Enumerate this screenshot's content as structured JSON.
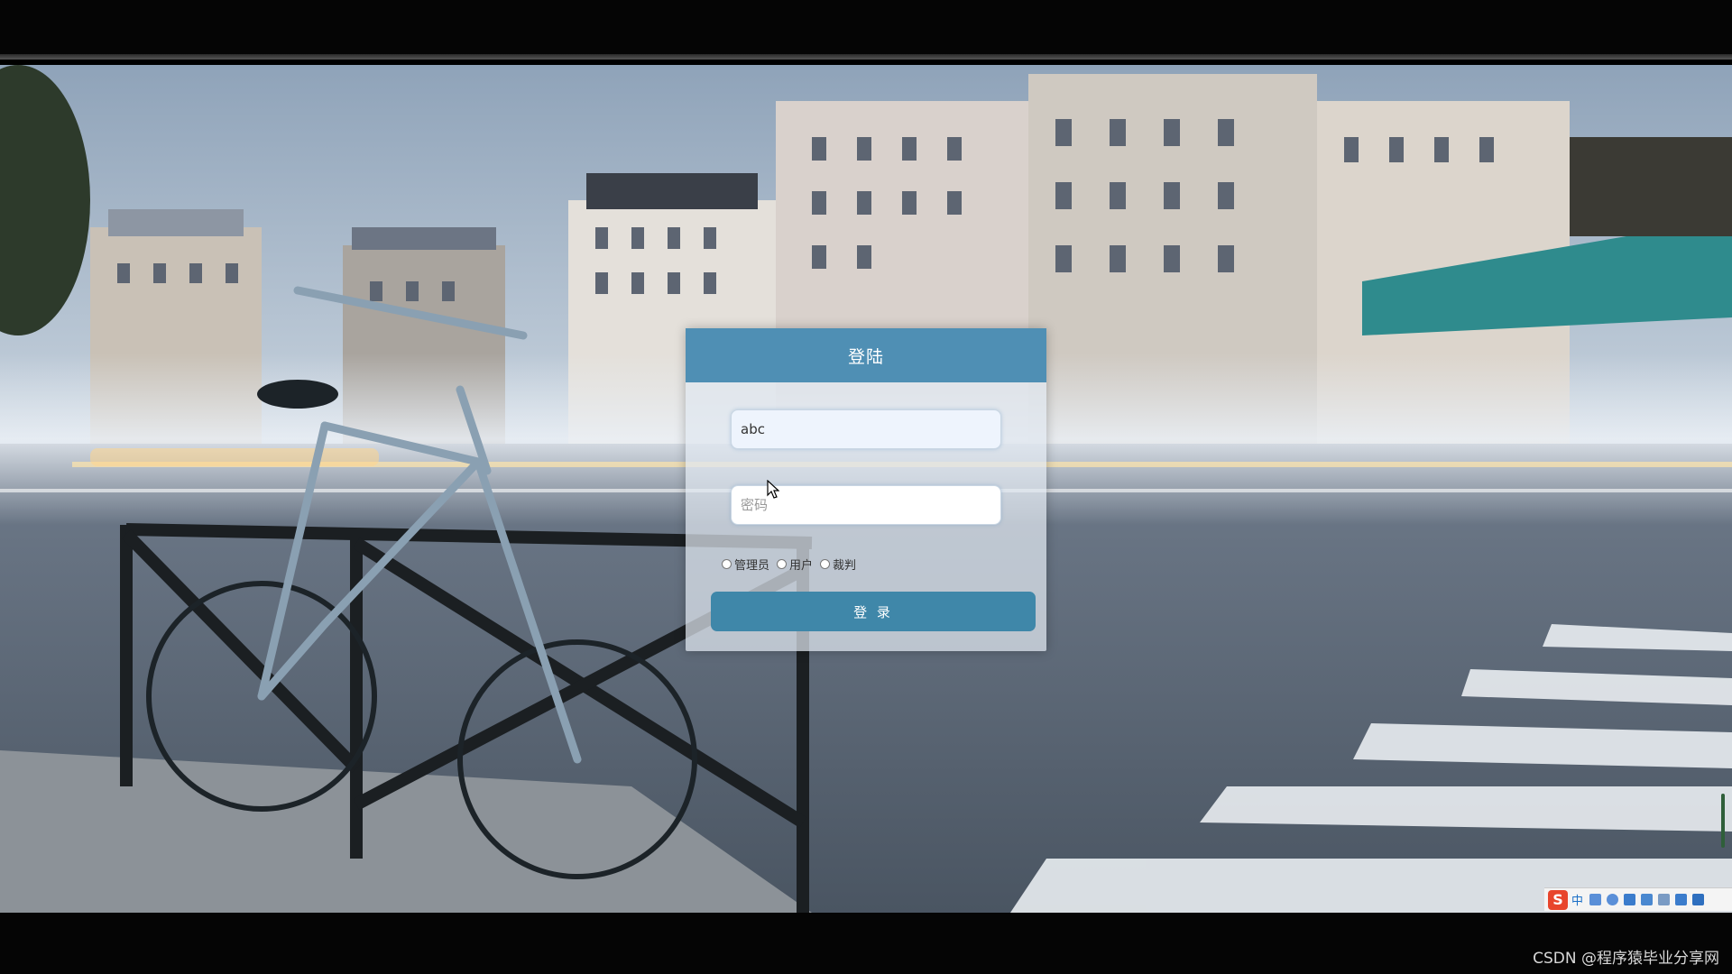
{
  "login": {
    "title": "登陆",
    "username_value": "abc",
    "password_placeholder": "密码",
    "roles": [
      {
        "label": "管理员",
        "selected": false
      },
      {
        "label": "用户",
        "selected": false
      },
      {
        "label": "裁判",
        "selected": false
      }
    ],
    "submit_label": "登 录"
  },
  "ime": {
    "logo": "S",
    "mode": "中"
  },
  "watermark": "CSDN @程序猿毕业分享网",
  "colors": {
    "header": "#4f8fb4",
    "button": "#3f87a9",
    "ime_logo": "#e8452c"
  },
  "icons": [
    "mouse-cursor-icon",
    "sogou-ime-icon"
  ]
}
